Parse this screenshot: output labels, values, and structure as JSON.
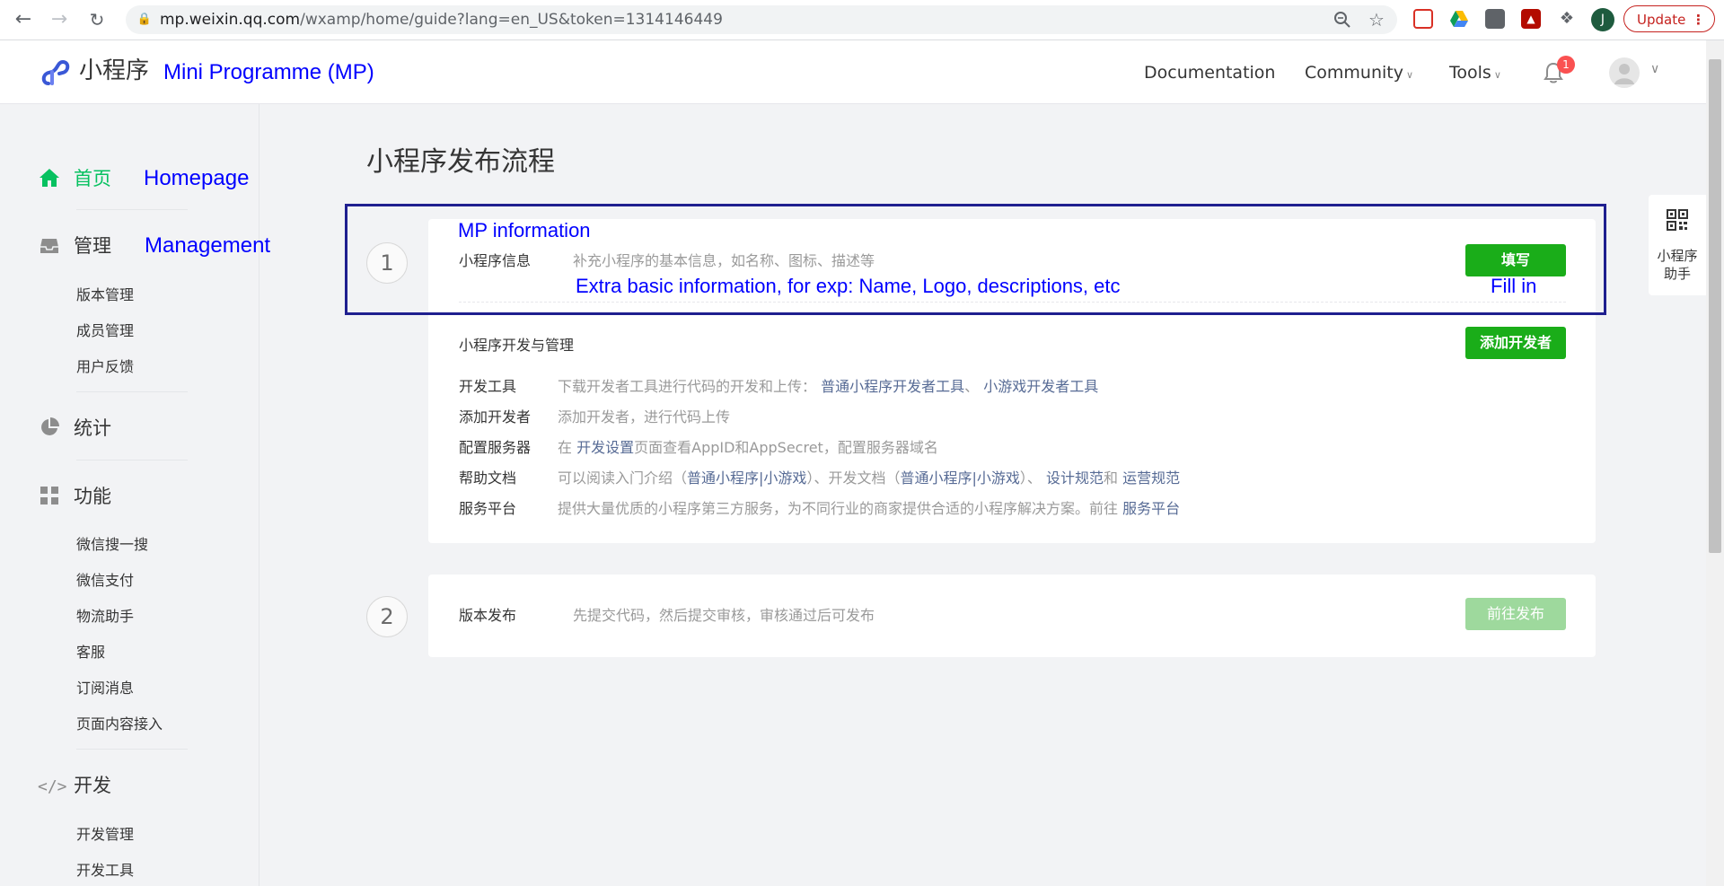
{
  "browser": {
    "url_host": "mp.weixin.qq.com",
    "url_path": "/wxamp/home/guide?lang=en_US&token=1314146449",
    "profile_initial": "J",
    "update_label": "Update",
    "icons": [
      "back-icon",
      "forward-icon",
      "reload-icon",
      "lock-icon",
      "zoom-icon",
      "star-icon",
      "extensions-icon",
      "menu-icon"
    ]
  },
  "header": {
    "logo_text": "小程序",
    "logo_annotation": "Mini Programme (MP)",
    "nav": {
      "documentation": "Documentation",
      "community": "Community",
      "tools": "Tools"
    },
    "notification_count": "1"
  },
  "sidebar": {
    "home": {
      "label": "首页",
      "annotation": "Homepage"
    },
    "management": {
      "label": "管理",
      "annotation": "Management",
      "items": [
        "版本管理",
        "成员管理",
        "用户反馈"
      ]
    },
    "stats": {
      "label": "统计"
    },
    "features": {
      "label": "功能",
      "items": [
        "微信搜一搜",
        "微信支付",
        "物流助手",
        "客服",
        "订阅消息",
        "页面内容接入"
      ]
    },
    "dev": {
      "label": "开发",
      "items": [
        "开发管理",
        "开发工具"
      ]
    }
  },
  "main": {
    "page_title": "小程序发布流程",
    "step1": {
      "number": "1",
      "annotation_title": "MP information",
      "label": "小程序信息",
      "desc": "补充小程序的基本信息，如名称、图标、描述等",
      "annotation_desc": "Extra  basic information, for exp: Name, Logo, descriptions, etc",
      "button": "填写",
      "button_annotation": "Fill in",
      "dev_section_title": "小程序开发与管理",
      "add_dev_button": "添加开发者",
      "rows": [
        {
          "label": "开发工具",
          "text1": "下载开发者工具进行代码的开发和上传：",
          "link1": "普通小程序开发者工具",
          "text2": "、",
          "link2": "小游戏开发者工具"
        },
        {
          "label": "添加开发者",
          "text1": "添加开发者，进行代码上传"
        },
        {
          "label": "配置服务器",
          "text1": "在",
          "link1": "开发设置",
          "text2": "页面查看AppID和AppSecret，配置服务器域名"
        },
        {
          "label": "帮助文档",
          "text1": "可以阅读入门介绍（",
          "link1": "普通小程序",
          "sep1": "|",
          "link2": "小游戏",
          "text2": "）、开发文档（",
          "link3": "普通小程序",
          "sep2": "|",
          "link4": "小游戏",
          "text3": "）、",
          "link5": "设计规范",
          "text4": "和",
          "link6": "运营规范"
        },
        {
          "label": "服务平台",
          "text1": "提供大量优质的小程序第三方服务，为不同行业的商家提供合适的小程序解决方案。前往",
          "link1": "服务平台"
        }
      ]
    },
    "step2": {
      "number": "2",
      "label": "版本发布",
      "desc": "先提交代码，然后提交审核，审核通过后可发布",
      "button": "前往发布"
    }
  },
  "helper": {
    "label_line1": "小程序",
    "label_line2": "助手"
  },
  "colors": {
    "brand_green": "#1aad19",
    "link_blue": "#576b95",
    "annotation_blue": "#0000ff",
    "active_green": "#07c160"
  }
}
